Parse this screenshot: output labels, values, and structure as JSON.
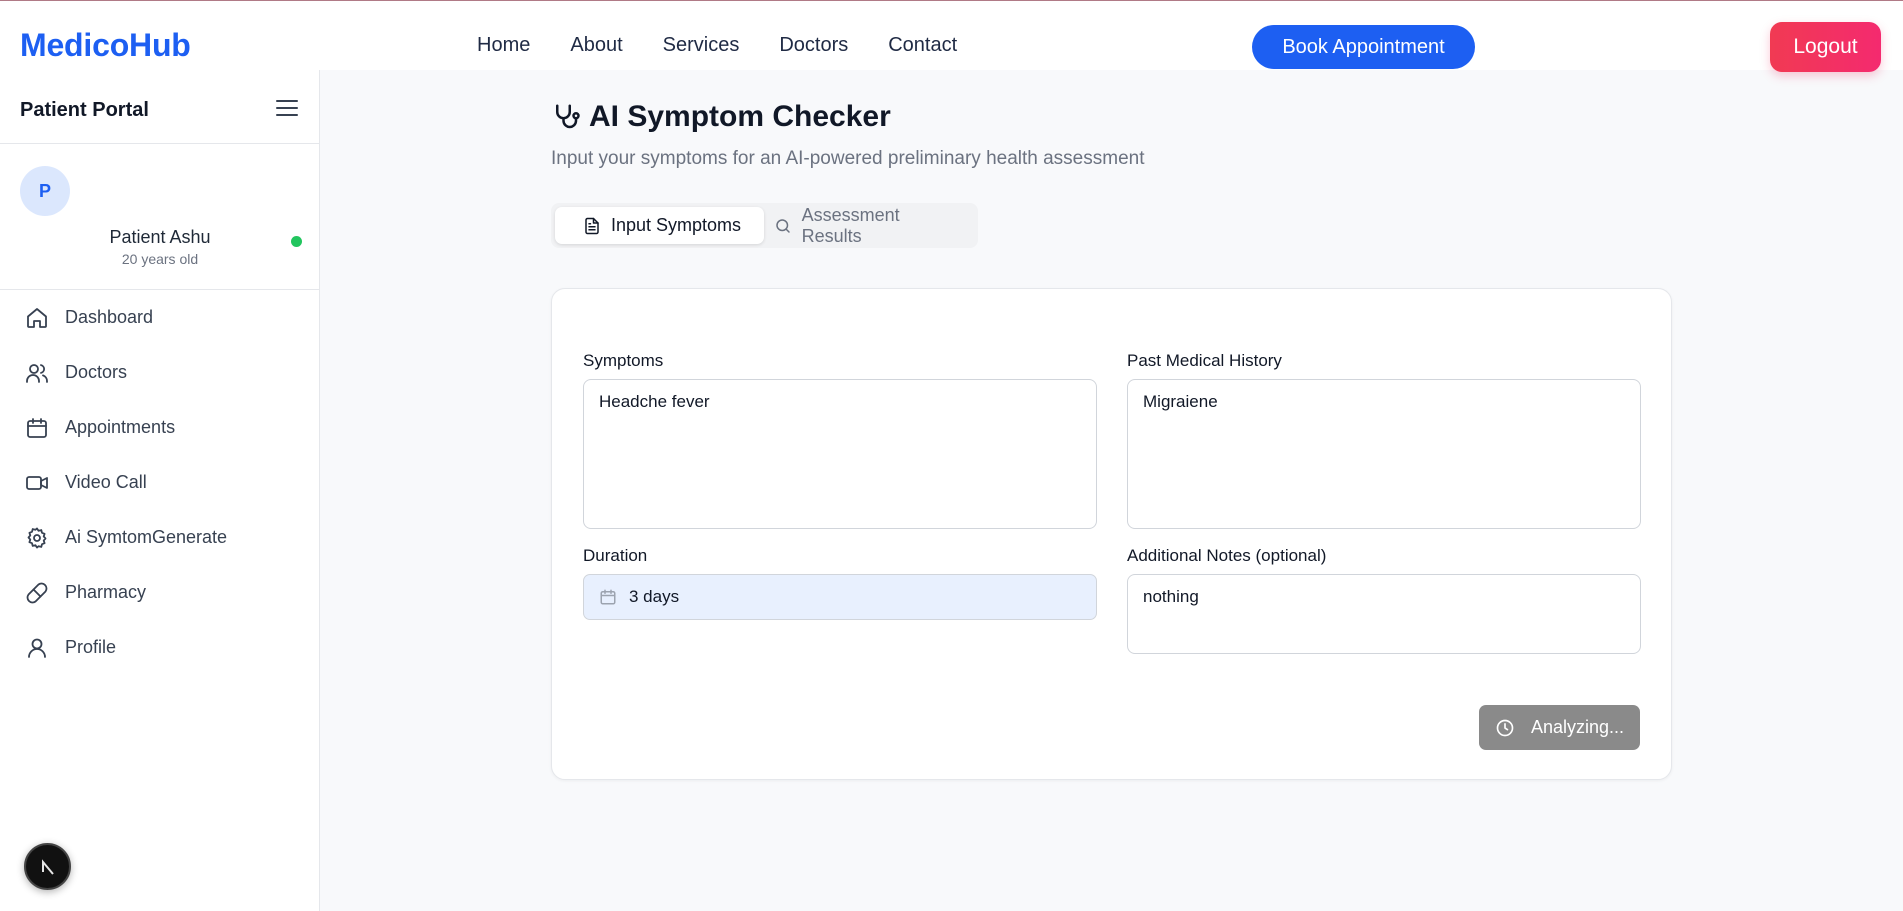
{
  "brand": "MedicoHub",
  "nav": {
    "links": [
      "Home",
      "About",
      "Services",
      "Doctors",
      "Contact"
    ],
    "book_label": "Book Appointment",
    "logout_label": "Logout"
  },
  "sidebar": {
    "title": "Patient Portal",
    "avatar_initial": "P",
    "patient_name": "Patient Ashu",
    "patient_age": "20 years old",
    "items": [
      {
        "label": "Dashboard",
        "icon": "home-icon"
      },
      {
        "label": "Doctors",
        "icon": "users-icon"
      },
      {
        "label": "Appointments",
        "icon": "calendar-icon"
      },
      {
        "label": "Video Call",
        "icon": "video-icon"
      },
      {
        "label": "Ai SymtomGenerate",
        "icon": "gear-icon"
      },
      {
        "label": "Pharmacy",
        "icon": "pill-icon"
      },
      {
        "label": "Profile",
        "icon": "user-icon"
      }
    ]
  },
  "main": {
    "title": "AI Symptom Checker",
    "subtitle": "Input your symptoms for an AI-powered preliminary health assessment",
    "tabs": [
      {
        "label": "Input Symptoms",
        "active": true
      },
      {
        "label": "Assessment Results",
        "active": false
      }
    ],
    "form": {
      "symptoms_label": "Symptoms",
      "symptoms_value": "Headche fever",
      "history_label": "Past Medical History",
      "history_value": "Migraiene",
      "duration_label": "Duration",
      "duration_value": "3 days",
      "notes_label": "Additional Notes (optional)",
      "notes_value": "nothing",
      "submit_label": "Analyzing..."
    }
  },
  "colors": {
    "brand": "#1d5ff2",
    "logout": "#f13a53",
    "online": "#22c55e",
    "button_disabled": "#8a8a8a"
  }
}
